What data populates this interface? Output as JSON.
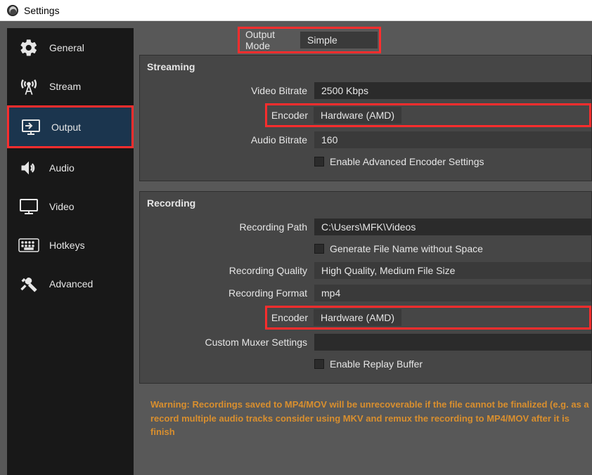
{
  "window": {
    "title": "Settings"
  },
  "sidebar": {
    "items": [
      {
        "label": "General",
        "icon": "gear-icon"
      },
      {
        "label": "Stream",
        "icon": "antenna-icon"
      },
      {
        "label": "Output",
        "icon": "monitor-output-icon"
      },
      {
        "label": "Audio",
        "icon": "speaker-icon"
      },
      {
        "label": "Video",
        "icon": "monitor-icon"
      },
      {
        "label": "Hotkeys",
        "icon": "keyboard-icon"
      },
      {
        "label": "Advanced",
        "icon": "tools-icon"
      }
    ]
  },
  "output_mode": {
    "label": "Output Mode",
    "value": "Simple"
  },
  "streaming": {
    "title": "Streaming",
    "video_bitrate": {
      "label": "Video Bitrate",
      "value": "2500 Kbps"
    },
    "encoder": {
      "label": "Encoder",
      "value": "Hardware (AMD)"
    },
    "audio_bitrate": {
      "label": "Audio Bitrate",
      "value": "160"
    },
    "enable_advanced": {
      "label": "Enable Advanced Encoder Settings",
      "checked": false
    }
  },
  "recording": {
    "title": "Recording",
    "path": {
      "label": "Recording Path",
      "value": "C:\\Users\\MFK\\Videos"
    },
    "no_space": {
      "label": "Generate File Name without Space",
      "checked": false
    },
    "quality": {
      "label": "Recording Quality",
      "value": "High Quality, Medium File Size"
    },
    "format": {
      "label": "Recording Format",
      "value": "mp4"
    },
    "encoder": {
      "label": "Encoder",
      "value": "Hardware (AMD)"
    },
    "muxer": {
      "label": "Custom Muxer Settings",
      "value": ""
    },
    "replay_buffer": {
      "label": "Enable Replay Buffer",
      "checked": false
    }
  },
  "warning": {
    "line1": "Warning: Recordings saved to MP4/MOV will be unrecoverable if the file cannot be finalized (e.g. as a",
    "line2": "record multiple audio tracks consider using MKV and remux the recording to MP4/MOV after it is finish"
  }
}
